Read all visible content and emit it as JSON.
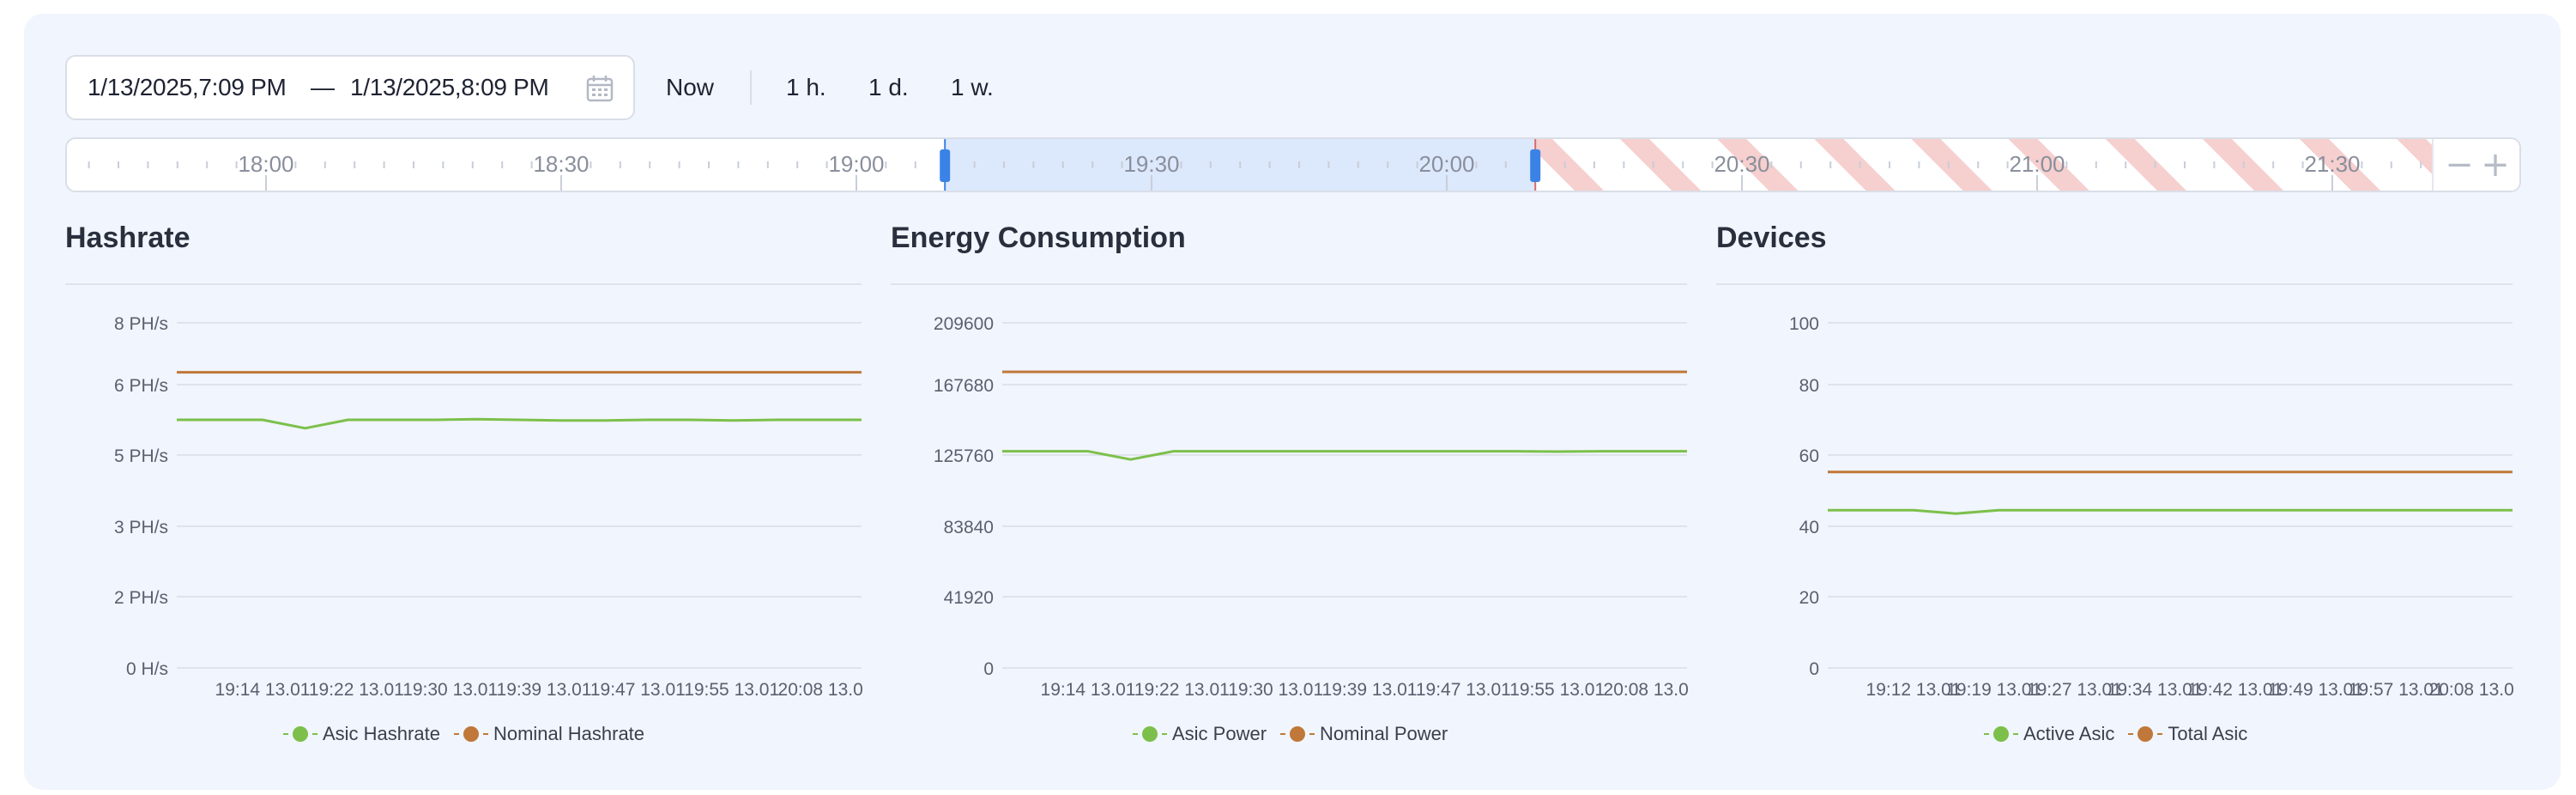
{
  "range": {
    "start": "1/13/2025,7:09 PM",
    "separator": "—",
    "end": "1/13/2025,8:09 PM",
    "calendar_icon": "calendar-icon"
  },
  "quick": {
    "now": "Now",
    "hour": "1 h.",
    "day": "1 d.",
    "week": "1 w."
  },
  "timeline": {
    "labels": [
      "18:00",
      "18:30",
      "19:00",
      "19:30",
      "20:00",
      "20:30",
      "21:00",
      "21:30"
    ],
    "selection_start": "19:09",
    "selection_end": "20:09",
    "zoom_out": "−",
    "zoom_in": "+"
  },
  "colors": {
    "green": "#7cc04b",
    "orange": "#c0783a",
    "grid": "#dfe3ea",
    "axis_text": "#5b6070",
    "selection": "#dce8fb",
    "handle": "#3b82e6",
    "future_stripe": "#f6cfcf"
  },
  "charts": [
    {
      "title": "Hashrate",
      "chart_data": {
        "type": "line",
        "y_ticks": [
          "8 PH/s",
          "6 PH/s",
          "5 PH/s",
          "3 PH/s",
          "2 PH/s",
          "0 H/s"
        ],
        "x_ticks": [
          "19:14 13.01",
          "19:22 13.01",
          "19:30 13.01",
          "19:39 13.01",
          "19:47 13.01",
          "19:55 13.01",
          "20:08 13.01"
        ],
        "ylim": [
          0,
          8.5
        ],
        "series": [
          {
            "name": "Asic Hashrate",
            "color": "green",
            "values": [
              5.5,
              5.5,
              5.5,
              5.38,
              5.5,
              5.5,
              5.5,
              5.51,
              5.5,
              5.49,
              5.49,
              5.5,
              5.5,
              5.49,
              5.5,
              5.5,
              5.5
            ]
          },
          {
            "name": "Nominal Hashrate",
            "color": "orange",
            "values": [
              6.4,
              6.4,
              6.4,
              6.4,
              6.4,
              6.4,
              6.4,
              6.4,
              6.4,
              6.4,
              6.4,
              6.4,
              6.4,
              6.4,
              6.4,
              6.4,
              6.4
            ]
          }
        ]
      }
    },
    {
      "title": "Energy Consumption",
      "chart_data": {
        "type": "line",
        "y_ticks": [
          "209600",
          "167680",
          "125760",
          "83840",
          "41920",
          "0"
        ],
        "x_ticks": [
          "19:14 13.01",
          "19:22 13.01",
          "19:30 13.01",
          "19:39 13.01",
          "19:47 13.01",
          "19:55 13.01",
          "20:08 13.01"
        ],
        "ylim": [
          0,
          209600
        ],
        "series": [
          {
            "name": "Asic Power",
            "color": "green",
            "values": [
              132000,
              132000,
              132000,
              127000,
              132000,
              132000,
              132000,
              132000,
              132000,
              132000,
              132000,
              132000,
              132000,
              131800,
              132000,
              132000,
              132000
            ]
          },
          {
            "name": "Nominal Power",
            "color": "orange",
            "values": [
              180000,
              180000,
              180000,
              180000,
              180000,
              180000,
              180000,
              180000,
              180000,
              180000,
              180000,
              180000,
              180000,
              180000,
              180000,
              180000,
              180000
            ]
          }
        ]
      }
    },
    {
      "title": "Devices",
      "chart_data": {
        "type": "line",
        "y_ticks": [
          "100",
          "80",
          "60",
          "40",
          "20",
          "0"
        ],
        "x_ticks": [
          "19:12 13.01",
          "19:19 13.01",
          "19:27 13.01",
          "19:34 13.01",
          "19:42 13.01",
          "19:49 13.01",
          "19:57 13.01",
          "20:08 13.01"
        ],
        "ylim": [
          0,
          100
        ],
        "series": [
          {
            "name": "Active Asic",
            "color": "green",
            "values": [
              46,
              46,
              46,
              45,
              46,
              46,
              46,
              46,
              46,
              46,
              46,
              46,
              46,
              46,
              46,
              46,
              46
            ]
          },
          {
            "name": "Total Asic",
            "color": "orange",
            "values": [
              57,
              57,
              57,
              57,
              57,
              57,
              57,
              57,
              57,
              57,
              57,
              57,
              57,
              57,
              57,
              57,
              57
            ]
          }
        ]
      }
    }
  ]
}
